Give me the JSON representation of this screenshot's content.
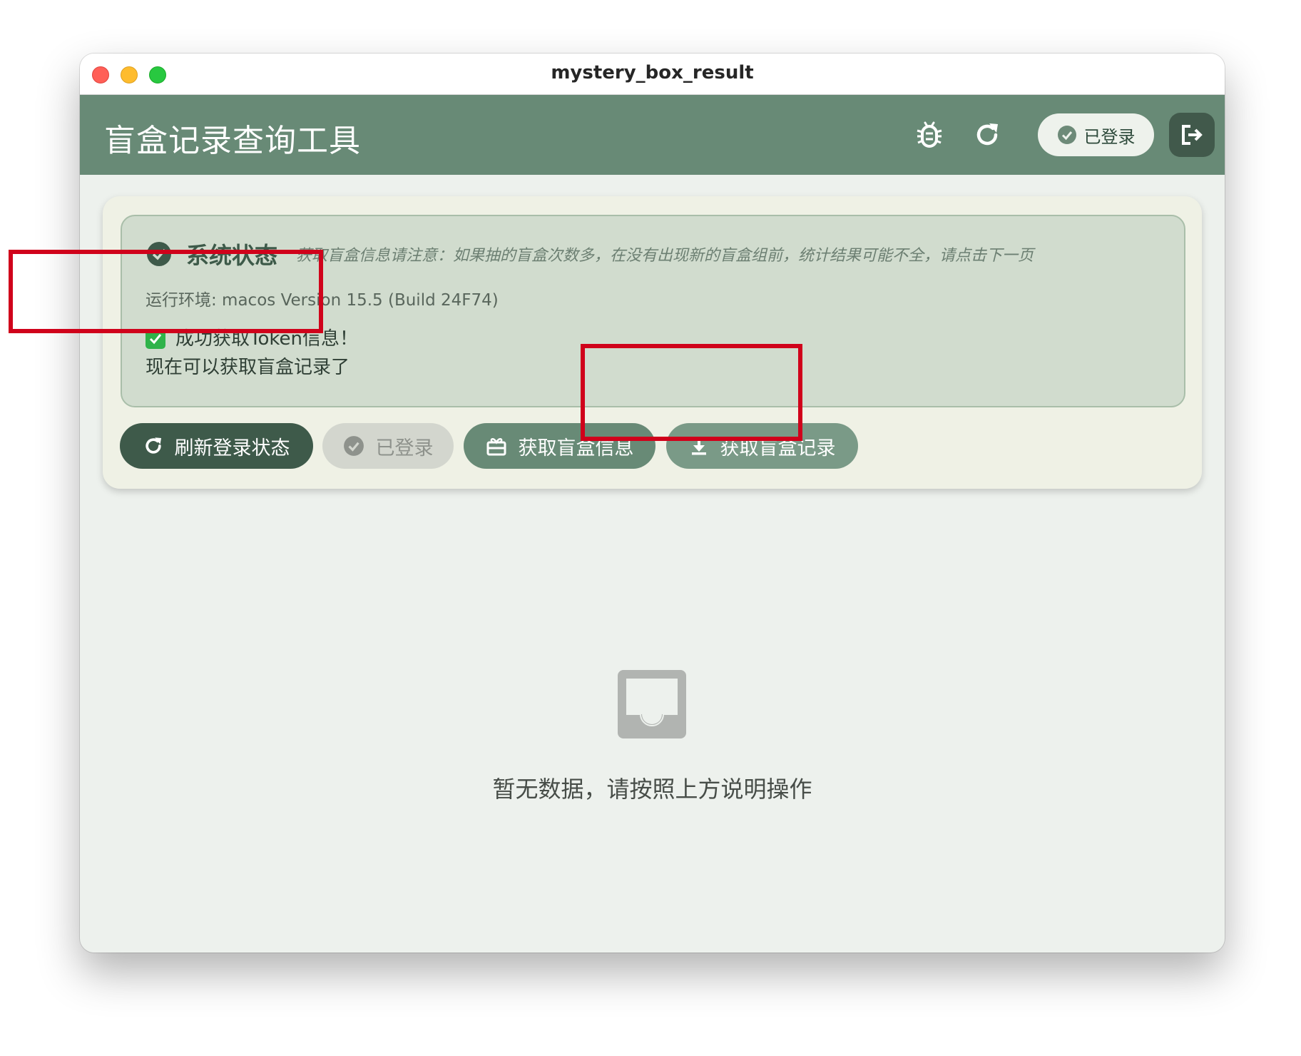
{
  "window": {
    "title": "mystery_box_result"
  },
  "appbar": {
    "title": "盲盒记录查询工具",
    "icons": [
      "bug-icon",
      "refresh-icon",
      "logout-icon"
    ],
    "login_status_label": "已登录"
  },
  "status": {
    "title": "系统状态",
    "note": "获取盲盒信息请注意：如果抽的盲盒次数多，在没有出现新的盲盒组前，统计结果可能不全，请点击下一页",
    "environment": "运行环境: macos Version 15.5 (Build 24F74)",
    "token_line1": "成功获取Token信息！",
    "token_line2": "现在可以获取盲盒记录了"
  },
  "actions": {
    "refresh_login": "刷新登录状态",
    "logged_in": "已登录",
    "get_box_info": "获取盲盒信息",
    "get_box_records": "获取盲盒记录"
  },
  "empty_state": {
    "message": "暂无数据，请按照上方说明操作",
    "icon": "inbox-icon"
  },
  "colors": {
    "appbar": "#688a76",
    "primary_dark": "#3e5a4a",
    "highlight": "#d0021b"
  }
}
